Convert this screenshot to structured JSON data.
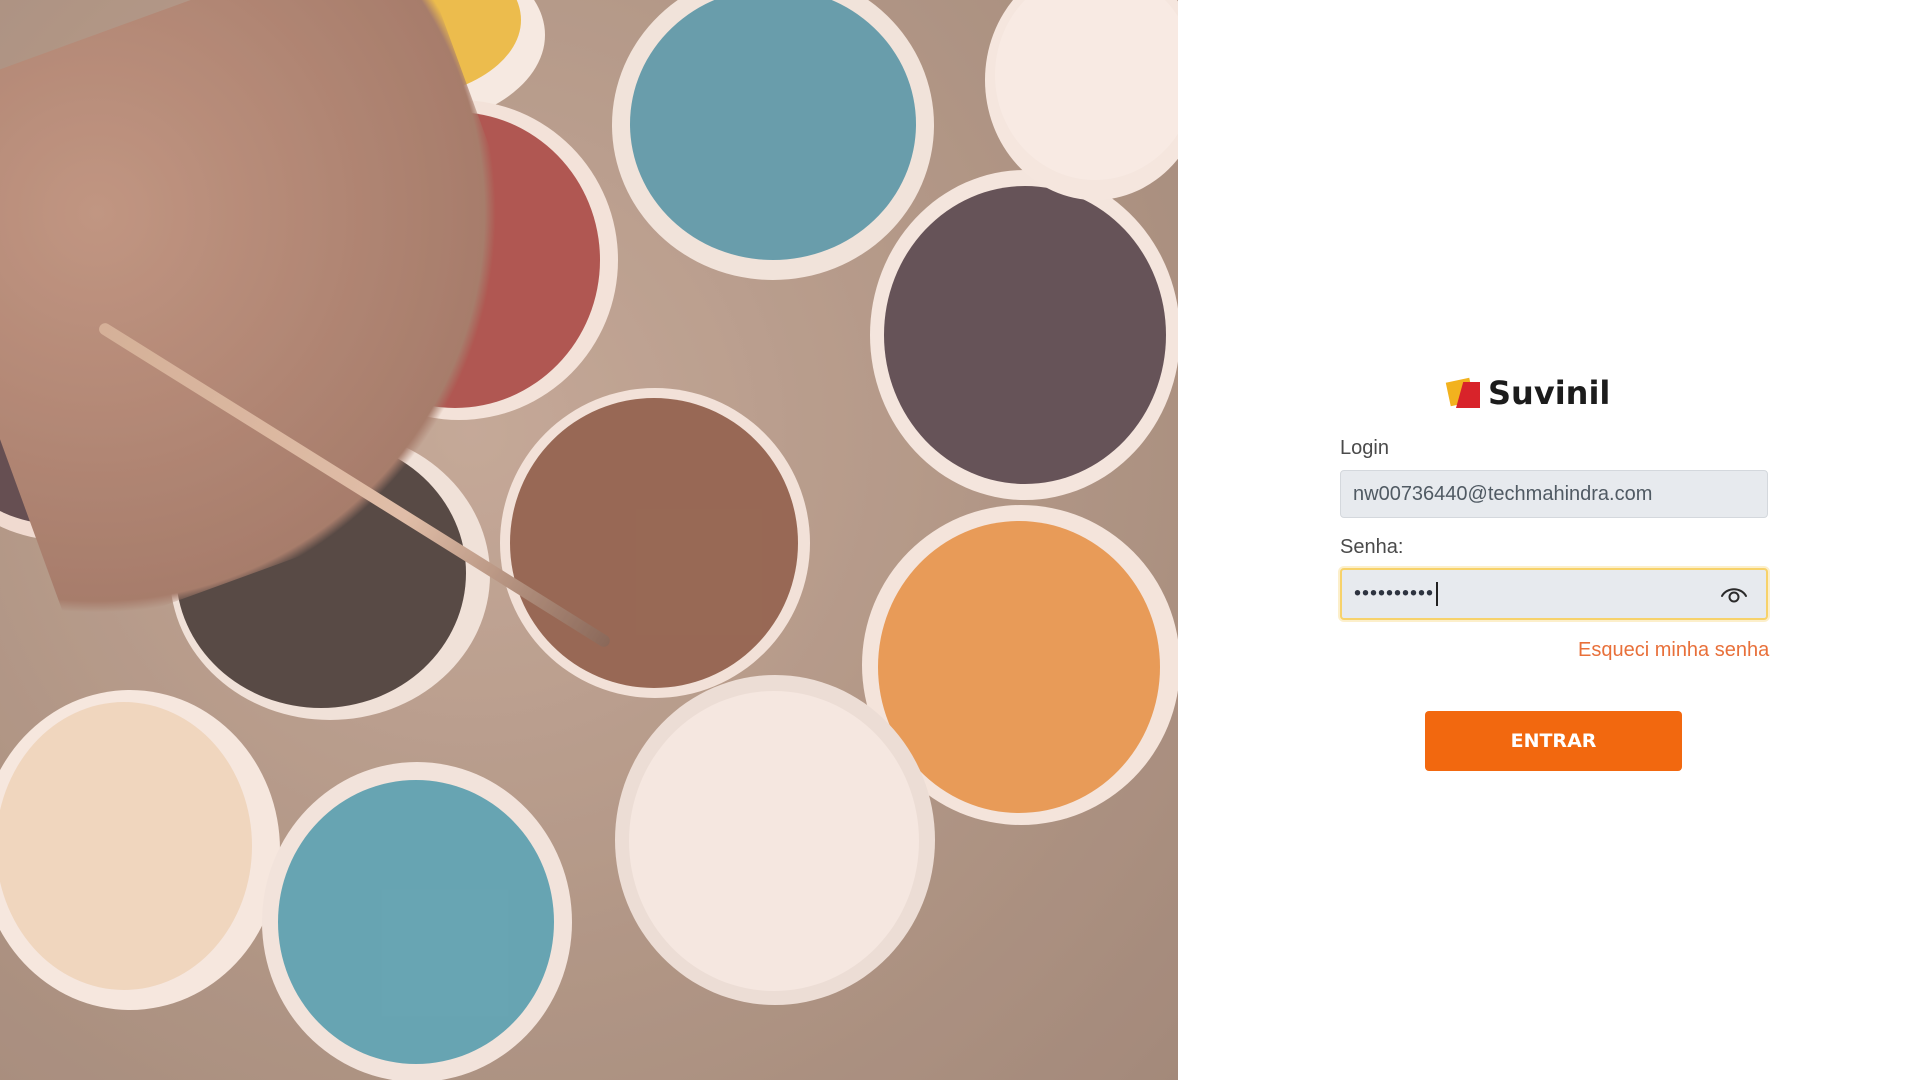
{
  "brand": {
    "name": "Suvinil"
  },
  "form": {
    "login_label": "Login",
    "login_value": "nw00736440@techmahindra.com",
    "password_label": "Senha:",
    "password_masked": "••••••••••",
    "forgot_label": "Esqueci minha senha",
    "submit_label": "ENTRAR"
  },
  "icons": {
    "show_password": "eye-icon"
  },
  "colors": {
    "primary": "#f2680f",
    "link": "#e8703a",
    "focus_border": "#f7d26a",
    "field_bg": "#e7eaee"
  }
}
